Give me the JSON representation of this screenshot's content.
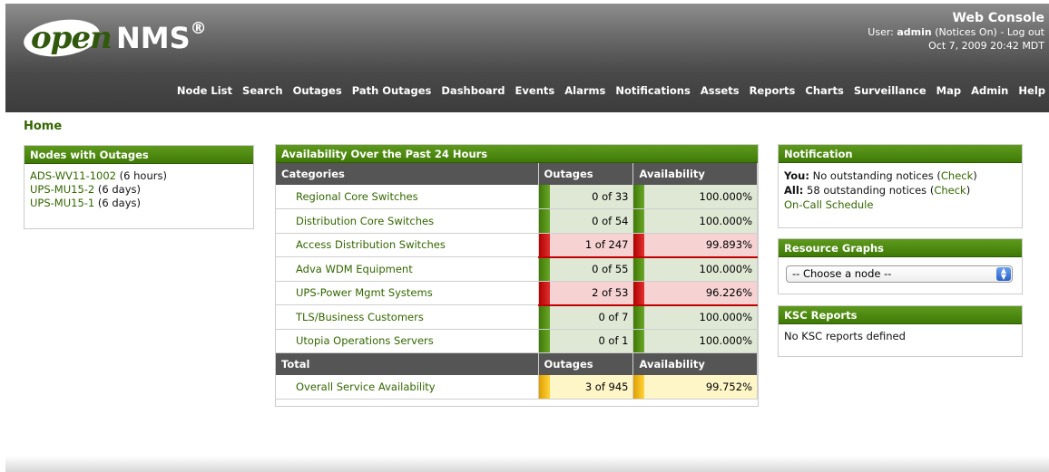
{
  "header": {
    "logo_open": "open",
    "logo_nms": "NMS",
    "logo_reg": "®",
    "console_title": "Web Console",
    "user_label": "User:",
    "user_name": "admin",
    "notices_status": "(Notices On)",
    "separator": "-",
    "logout": "Log out",
    "datetime": "Oct 7, 2009  20:42 MDT"
  },
  "nav": [
    "Node List",
    "Search",
    "Outages",
    "Path Outages",
    "Dashboard",
    "Events",
    "Alarms",
    "Notifications",
    "Assets",
    "Reports",
    "Charts",
    "Surveillance",
    "Map",
    "Admin",
    "Help"
  ],
  "breadcrumb": "Home",
  "outages_panel": {
    "title": "Nodes with Outages",
    "items": [
      {
        "node": "ADS-WV11-1002",
        "duration": "(6 hours)"
      },
      {
        "node": "UPS-MU15-2",
        "duration": "(6 days)"
      },
      {
        "node": "UPS-MU15-1",
        "duration": "(6 days)"
      }
    ]
  },
  "availability": {
    "title": "Availability Over the Past 24 Hours",
    "headers": {
      "categories": "Categories",
      "outages": "Outages",
      "availability": "Availability"
    },
    "rows": [
      {
        "name": "Regional Core Switches",
        "outages": "0 of 33",
        "availability": "100.000%",
        "status": "ok"
      },
      {
        "name": "Distribution Core Switches",
        "outages": "0 of 54",
        "availability": "100.000%",
        "status": "ok"
      },
      {
        "name": "Access Distribution Switches",
        "outages": "1 of 247",
        "availability": "99.893%",
        "status": "bad"
      },
      {
        "name": "Adva WDM Equipment",
        "outages": "0 of 55",
        "availability": "100.000%",
        "status": "ok"
      },
      {
        "name": "UPS-Power Mgmt Systems",
        "outages": "2 of 53",
        "availability": "96.226%",
        "status": "bad"
      },
      {
        "name": "TLS/Business Customers",
        "outages": "0 of 7",
        "availability": "100.000%",
        "status": "ok"
      },
      {
        "name": "Utopia Operations Servers",
        "outages": "0 of 1",
        "availability": "100.000%",
        "status": "ok"
      }
    ],
    "total_headers": {
      "total": "Total",
      "outages": "Outages",
      "availability": "Availability"
    },
    "total_row": {
      "name": "Overall Service Availability",
      "outages": "3 of 945",
      "availability": "99.752%",
      "status": "warn"
    }
  },
  "notification": {
    "title": "Notification",
    "you_label": "You:",
    "you_text": "No outstanding notices (",
    "all_label": "All:",
    "all_text": "58 outstanding notices (",
    "check": "Check",
    "close_paren": ")",
    "oncall": "On-Call Schedule"
  },
  "resource_graphs": {
    "title": "Resource Graphs",
    "selected": "-- Choose a node --"
  },
  "ksc": {
    "title": "KSC Reports",
    "text": "No KSC reports defined"
  },
  "colors": {
    "brand_green": "#336600",
    "panel_green": "#4a8a10",
    "ok_bg": "#dfe8d5",
    "bad_bg": "#f6d2d2",
    "warn_bg": "#fff6c8",
    "header_dark": "#3c3c3c"
  }
}
